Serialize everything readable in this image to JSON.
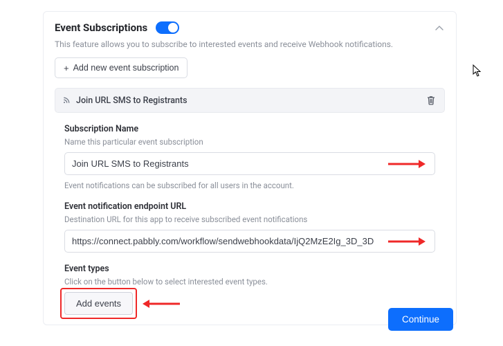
{
  "panel": {
    "title": "Event Subscriptions",
    "toggle_on": true,
    "description": "This feature allows you to subscribe to interested events and receive Webhook notifications.",
    "add_new_label": "Add new event subscription"
  },
  "subscription": {
    "bar_label": "Join URL SMS to Registrants",
    "name_label": "Subscription Name",
    "name_help": "Name this particular event subscription",
    "name_value": "Join URL SMS to Registrants",
    "name_note": "Event notifications can be subscribed for all users in the account.",
    "url_label": "Event notification endpoint URL",
    "url_help": "Destination URL for this app to receive subscribed event notifications",
    "url_value": "https://connect.pabbly.com/workflow/sendwebhookdata/IjQ2MzE2Ig_3D_3D",
    "types_label": "Event types",
    "types_help": "Click on the button below to select interested event types.",
    "add_events_label": "Add events"
  },
  "footer": {
    "continue_label": "Continue"
  },
  "colors": {
    "primary": "#0d6efd",
    "highlight": "#ef2828"
  }
}
